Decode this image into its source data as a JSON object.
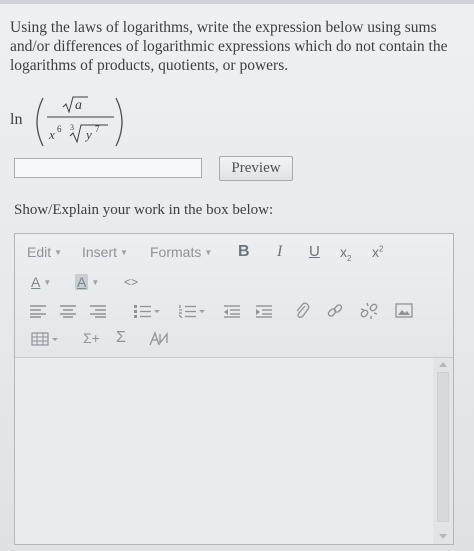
{
  "question": {
    "text": "Using the laws of logarithms, write the expression below using sums and/or differences of logarithmic expressions which do not contain the logarithms of products, quotients, or powers."
  },
  "expression": {
    "ln": "ln",
    "numerator_radicand": "a",
    "denominator_base": "x",
    "denominator_exponent": "6",
    "root_index": "3",
    "root_radicand_base": "y",
    "root_radicand_exponent": "7"
  },
  "answer": {
    "value": ""
  },
  "preview_button": {
    "label": "Preview"
  },
  "work_label": "Show/Explain your work in the box below:",
  "editor": {
    "menus": [
      "Edit",
      "Insert",
      "Formats"
    ],
    "bold": "B",
    "italic": "I",
    "underline": "U",
    "subscript": "x",
    "subscript_mark": "2",
    "superscript": "x",
    "superscript_mark": "2",
    "font_color": "A",
    "bg_color": "A",
    "source_code": "<>",
    "sigma_insert": "Σ+",
    "sigma": "Σ",
    "content": ""
  }
}
